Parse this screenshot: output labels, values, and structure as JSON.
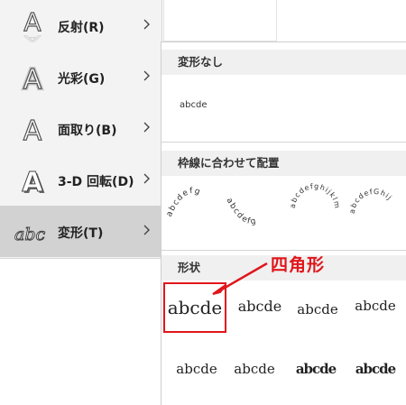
{
  "menu": {
    "items": [
      {
        "label": "反射(R)",
        "icon": "reflection-icon"
      },
      {
        "label": "光彩(G)",
        "icon": "glow-icon"
      },
      {
        "label": "面取り(B)",
        "icon": "bevel-icon"
      },
      {
        "label": "3-D 回転(D)",
        "icon": "3d-rotation-icon"
      },
      {
        "label": "変形(T)",
        "icon": "transform-icon",
        "selected": true
      }
    ]
  },
  "gallery": {
    "no_transform": {
      "header": "変形なし",
      "sample": "abcde"
    },
    "follow_path": {
      "header": "枠線に合わせて配置",
      "samples": [
        "abcdefg",
        "abcdefg",
        "abcdefghijklm",
        "abcdefGhij"
      ]
    },
    "warp": {
      "header": "形状",
      "samples": [
        "abcde",
        "abcde",
        "abcde",
        "abcde",
        "abcde",
        "abcde",
        "abcde",
        "abcde"
      ],
      "selected_index": 0
    }
  },
  "callout": {
    "text": "四角形",
    "color": "#e0161b"
  }
}
